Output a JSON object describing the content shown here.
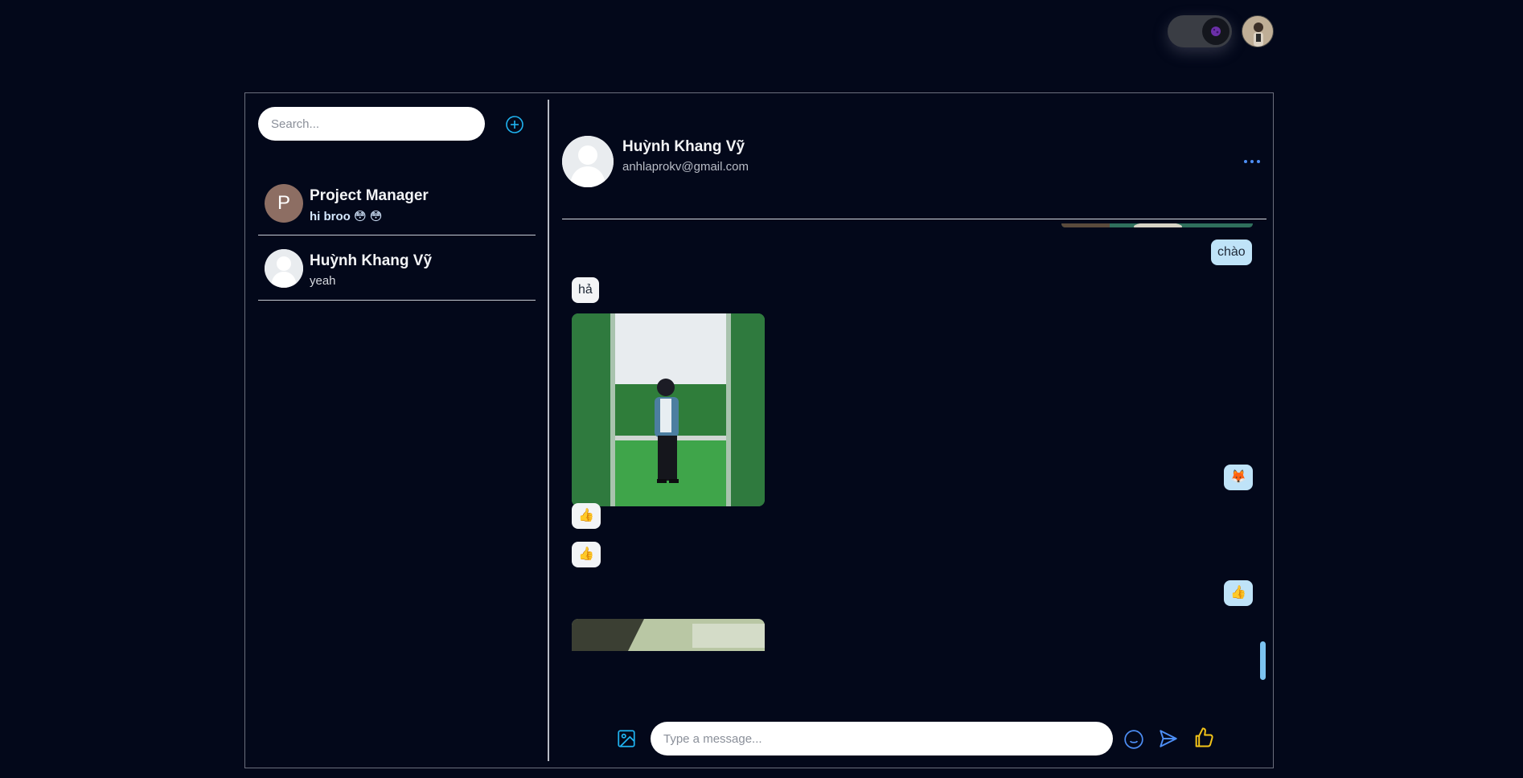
{
  "topbar": {
    "theme_toggle": "dark-mode",
    "profile_icon": "user-avatar"
  },
  "sidebar": {
    "search_placeholder": "Search...",
    "add_icon": "plus-circle-icon",
    "conversations": [
      {
        "avatar_letter": "P",
        "name": "Project Manager",
        "last_message": "hi broo 😳 😳",
        "unread": true
      },
      {
        "avatar_letter": "",
        "name": "Huỳnh Khang Vỹ",
        "last_message": "yeah",
        "unread": false
      }
    ]
  },
  "chat": {
    "contact_name": "Huỳnh Khang Vỹ",
    "contact_email": "anhlaprokv@gmail.com",
    "more_icon": "more-horizontal-icon",
    "messages": [
      {
        "side": "out",
        "type": "image"
      },
      {
        "side": "out",
        "type": "text",
        "text": "chào"
      },
      {
        "side": "in",
        "type": "text",
        "text": "hả"
      },
      {
        "side": "in",
        "type": "image"
      },
      {
        "side": "out",
        "type": "text",
        "text": "🦊"
      },
      {
        "side": "in",
        "type": "text",
        "text": "👍"
      },
      {
        "side": "in",
        "type": "text",
        "text": "👍"
      },
      {
        "side": "out",
        "type": "text",
        "text": "👍"
      },
      {
        "side": "in",
        "type": "image"
      }
    ],
    "composer": {
      "placeholder": "Type a message...",
      "image_icon": "image-icon",
      "emoji_icon": "smile-icon",
      "send_icon": "send-icon",
      "like_icon": "thumbs-up-icon"
    }
  },
  "colors": {
    "background": "#03081a",
    "accent": "#4d8ef5",
    "outgoing_bubble": "#bfe3f8",
    "incoming_bubble": "#f3f4f6",
    "like": "#f5c518"
  }
}
